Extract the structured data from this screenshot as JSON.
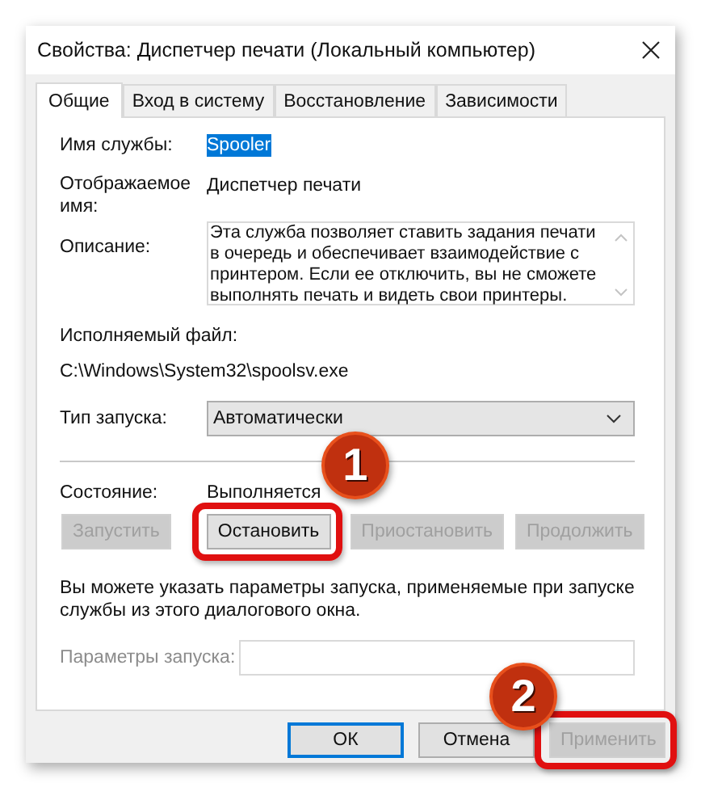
{
  "window": {
    "title": "Свойства: Диспетчер печати (Локальный компьютер)"
  },
  "tabs": [
    {
      "label": "Общие",
      "selected": true
    },
    {
      "label": "Вход в систему",
      "selected": false
    },
    {
      "label": "Восстановление",
      "selected": false
    },
    {
      "label": "Зависимости",
      "selected": false
    }
  ],
  "service_name": {
    "label": "Имя службы:",
    "value": "Spooler",
    "selected": true
  },
  "display_name": {
    "label": "Отображаемое имя:",
    "value": "Диспетчер печати"
  },
  "description": {
    "label": "Описание:",
    "value": "Эта служба позволяет ставить задания печати в очередь и обеспечивает взаимодействие с принтером. Если ее отключить, вы не сможете выполнять печать и видеть свои принтеры."
  },
  "executable": {
    "label": "Исполняемый файл:",
    "value": "C:\\Windows\\System32\\spoolsv.exe"
  },
  "startup_type": {
    "label": "Тип запуска:",
    "value": "Автоматически"
  },
  "status": {
    "label": "Состояние:",
    "value": "Выполняется"
  },
  "service_buttons": [
    {
      "label": "Запустить",
      "disabled": true,
      "highlighted": false
    },
    {
      "label": "Остановить",
      "disabled": false,
      "highlighted": true,
      "callout": "1"
    },
    {
      "label": "Приостановить",
      "disabled": true,
      "highlighted": false
    },
    {
      "label": "Продолжить",
      "disabled": true,
      "highlighted": false
    }
  ],
  "hint": "Вы можете указать параметры запуска, применяемые при запуске службы из этого диалогового окна.",
  "start_parameters": {
    "label": "Параметры запуска:",
    "disabled": true
  },
  "dialog_buttons": [
    {
      "label": "ОК",
      "disabled": false,
      "default": true,
      "highlighted": false
    },
    {
      "label": "Отмена",
      "disabled": false,
      "default": false,
      "highlighted": false
    },
    {
      "label": "Применить",
      "disabled": true,
      "default": false,
      "highlighted": true,
      "callout": "2"
    }
  ]
}
